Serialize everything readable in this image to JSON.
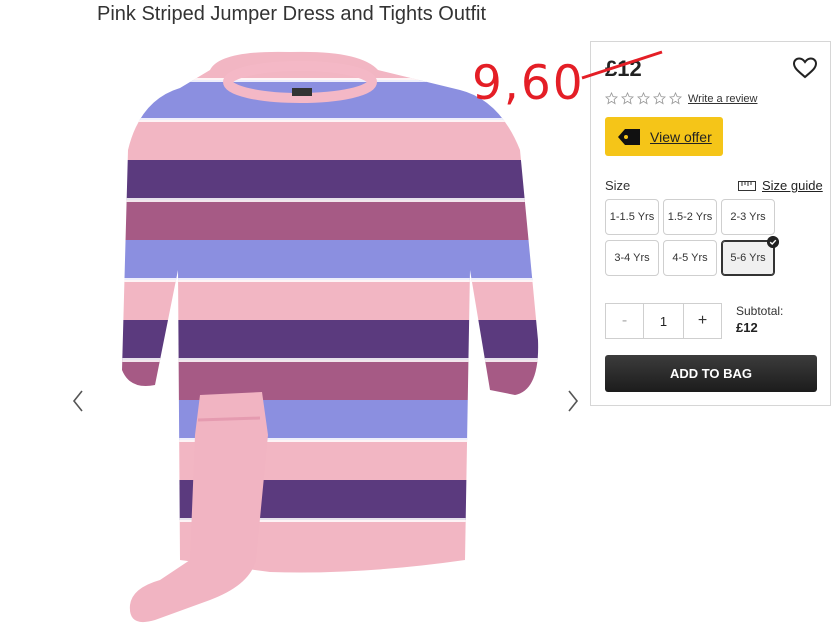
{
  "product": {
    "title": "Pink Striped Jumper Dress and Tights Outfit",
    "image": "pink-striped-jumper-dress-with-tights",
    "price": "£12",
    "annotated_price": "9,60"
  },
  "gallery": {
    "prev_icon": "chevron-left-icon",
    "next_icon": "chevron-right-icon"
  },
  "rating": {
    "stars": 0,
    "max": 5,
    "review_link": "Write a review"
  },
  "offer": {
    "label": "View offer",
    "color": "#f5c518",
    "icon": "tag-icon"
  },
  "size": {
    "label": "Size",
    "guide_label": "Size guide",
    "options": [
      "1-1.5 Yrs",
      "1.5-2 Yrs",
      "2-3 Yrs",
      "3-4 Yrs",
      "4-5 Yrs",
      "5-6 Yrs"
    ],
    "selected": "5-6 Yrs"
  },
  "quantity": {
    "minus": "-",
    "value": "1",
    "plus": "+"
  },
  "subtotal": {
    "label": "Subtotal:",
    "value": "£12"
  },
  "cart": {
    "add_label": "ADD TO BAG"
  },
  "colors": {
    "annotation": "#e41e26",
    "button_dark": "#222222",
    "offer": "#f5c518"
  }
}
